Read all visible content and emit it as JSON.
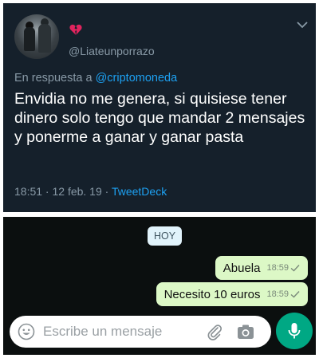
{
  "tweet": {
    "handle": "@Liateunporrazo",
    "reply_prefix": "En respuesta a ",
    "reply_to": "@criptomoneda",
    "text": "Envidia no me genera, si quisiese tener dinero solo tengo que mandar 2 mensajes y ponerme a ganar y ganar pasta",
    "timestamp": "18:51 · 12 feb. 19 · ",
    "client": "TweetDeck",
    "icons": [
      "avatar",
      "broken-heart-icon",
      "chevron-down-icon"
    ]
  },
  "chat": {
    "date_chip": "HOY",
    "messages": [
      {
        "text": "Abuela",
        "time": "18:59",
        "status_icon": "single-check-icon"
      },
      {
        "text": "Necesito 10 euros",
        "time": "18:59",
        "status_icon": "single-check-icon"
      }
    ],
    "input": {
      "placeholder": "Escribe un mensaje"
    },
    "icons": [
      "emoji-icon",
      "attach-clip-icon",
      "camera-icon",
      "microphone-icon"
    ]
  },
  "colors": {
    "tweet_bg": "#15202b",
    "link": "#1da1f2",
    "muted": "#8899a6",
    "chat_bg": "#0b0f0f",
    "bubble_out": "#dcf8c6",
    "accent_green": "#00a884"
  }
}
